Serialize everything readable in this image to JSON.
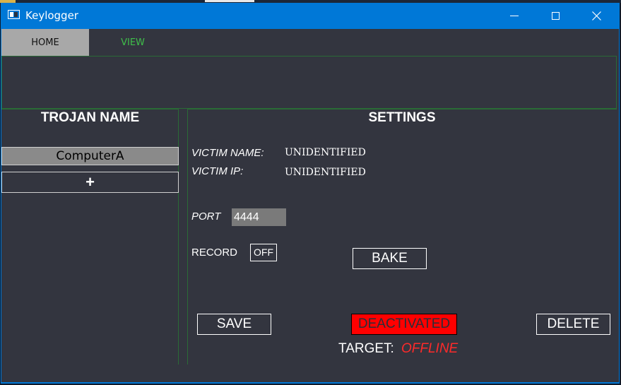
{
  "window": {
    "title": "Keylogger"
  },
  "tabs": [
    {
      "label": "HOME"
    },
    {
      "label": "VIEW"
    }
  ],
  "trojan_panel": {
    "heading": "TROJAN NAME",
    "items": [
      {
        "label": "ComputerA"
      }
    ],
    "add_label": "+"
  },
  "settings": {
    "heading": "SETTINGS",
    "victim_name_label": "VICTIM NAME:",
    "victim_name_value": "UNIDENTIFIED",
    "victim_ip_label": "VICTIM IP:",
    "victim_ip_value": "UNIDENTIFIED",
    "port_label": "PORT",
    "port_value": "4444",
    "record_label": "RECORD",
    "record_toggle": "OFF",
    "bake_label": "BAKE",
    "save_label": "SAVE",
    "status_label": "DEACTIVATED",
    "delete_label": "DELETE",
    "target_label": "TARGET:",
    "target_value": "OFFLINE"
  },
  "colors": {
    "titlebar": "#0078d7",
    "background": "#33353f",
    "active_tab": "#a8a8a8",
    "view_tab_text": "#3fbf4a",
    "panel_border": "#2a6b36",
    "status_bg": "#ff0000",
    "offline_text": "#ff2a2a"
  }
}
